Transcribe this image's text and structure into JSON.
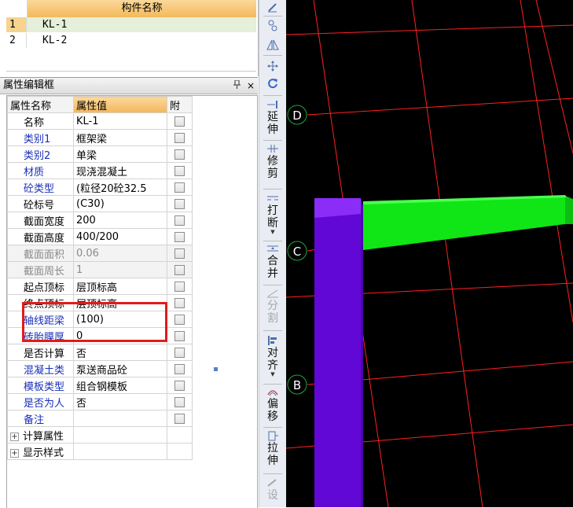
{
  "component_list": {
    "header": "构件名称",
    "rows": [
      {
        "index": "1",
        "name": "KL-1",
        "selected": true
      },
      {
        "index": "2",
        "name": "KL-2",
        "selected": false
      }
    ]
  },
  "property_panel": {
    "title": "属性编辑框",
    "pin_icon": "pin-icon",
    "close_label": "×",
    "columns": {
      "name": "属性名称",
      "value": "属性值",
      "attach": "附"
    },
    "rows": [
      {
        "name": "名称",
        "value": "KL-1"
      },
      {
        "name": "类别1",
        "value": "框架梁"
      },
      {
        "name": "类别2",
        "value": "单梁"
      },
      {
        "name": "材质",
        "value": "现浇混凝土"
      },
      {
        "name": "砼类型",
        "value": "(粒径20砼32.5"
      },
      {
        "name": "砼标号",
        "value": "(C30)"
      },
      {
        "name": "截面宽度",
        "value": "200"
      },
      {
        "name": "截面高度",
        "value": "400/200"
      },
      {
        "name": "截面面积",
        "value": "0.06"
      },
      {
        "name": "截面周长",
        "value": "1"
      },
      {
        "name": "起点顶标",
        "value": "层顶标高"
      },
      {
        "name": "终点顶标",
        "value": "层顶标高"
      },
      {
        "name": "轴线距梁",
        "value": "(100)"
      },
      {
        "name": "砖胎膜厚",
        "value": "0"
      },
      {
        "name": "是否计算",
        "value": "否"
      },
      {
        "name": "混凝土类",
        "value": "泵送商品砼"
      },
      {
        "name": "模板类型",
        "value": "组合钢模板"
      },
      {
        "name": "是否为人",
        "value": "否"
      },
      {
        "name": "备注",
        "value": ""
      }
    ],
    "groups": [
      {
        "expander": "+",
        "label": "计算属性"
      },
      {
        "expander": "+",
        "label": "显示样式"
      }
    ]
  },
  "toolbar": {
    "top_icons": [
      "brush-icon",
      "link-icon",
      "mirror-icon",
      "move-icon",
      "rotate-icon"
    ],
    "buttons": [
      {
        "icon": "extend-icon",
        "label": "延伸"
      },
      {
        "icon": "trim-icon",
        "label": "修剪"
      },
      {
        "icon": "break-icon",
        "label": "打断"
      },
      {
        "icon": "merge-icon",
        "label": "合并"
      },
      {
        "icon": "split-icon",
        "label": "分割"
      },
      {
        "icon": "align-icon",
        "label": "对齐"
      },
      {
        "icon": "offset-icon",
        "label": "偏移"
      },
      {
        "icon": "stretch-icon",
        "label": "拉伸"
      },
      {
        "icon": "settings-icon",
        "label": "设"
      }
    ]
  },
  "viewport": {
    "axis_labels": [
      "D",
      "C",
      "B"
    ],
    "colors": {
      "background": "#000000",
      "grid": "#ff2020",
      "column": "#7a12e6",
      "beam": "#17f01c",
      "axis_circle": "#1fa83a",
      "highlight_box": "#e21b1b",
      "header_accent": "#f3b95a"
    }
  }
}
